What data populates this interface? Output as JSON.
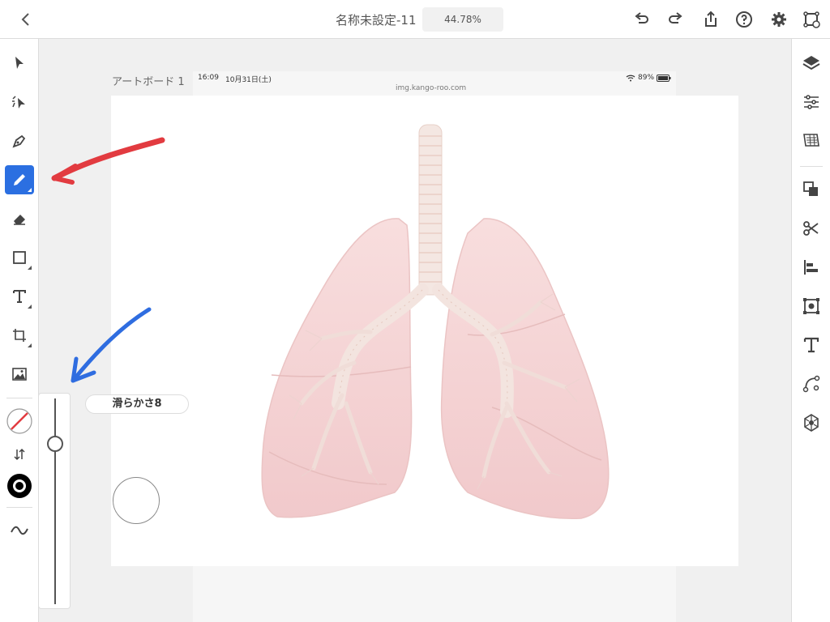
{
  "topbar": {
    "doc_title": "名称未設定-11",
    "zoom": "44.78%",
    "icons": [
      "back-icon",
      "undo-icon",
      "redo-icon",
      "share-icon",
      "help-icon",
      "gear-icon",
      "cloud-doc-icon"
    ]
  },
  "left_tools": [
    "select-icon",
    "direct-select-icon",
    "pen-icon",
    "pencil-icon",
    "eraser-icon",
    "rectangle-icon",
    "text-icon",
    "transform-icon",
    "image-icon",
    "stroke-color-icon",
    "swap-icon",
    "fill-color-icon",
    "smoothing-icon"
  ],
  "active_tool": "pencil",
  "right_tools": [
    "layers-icon",
    "properties-icon",
    "libraries-icon",
    "arrange-icon",
    "shape-builder-icon",
    "align-icon",
    "image-trace-icon",
    "text-panel-icon",
    "path-icon",
    "pattern-icon"
  ],
  "canvas": {
    "artboard_label": "アートボード 1",
    "status_time": "16:09",
    "status_date": "10月31日(土)",
    "status_url": "img.kango-roo.com",
    "status_battery": "89%"
  },
  "smoothing": {
    "label": "滑らかさ8",
    "value": 8
  },
  "colors": {
    "accent": "#2b6fe1",
    "lung": "#f6d5d5",
    "trachea": "#f3e6e0",
    "annotation_red": "#e23b40",
    "annotation_blue": "#2f6de0"
  }
}
